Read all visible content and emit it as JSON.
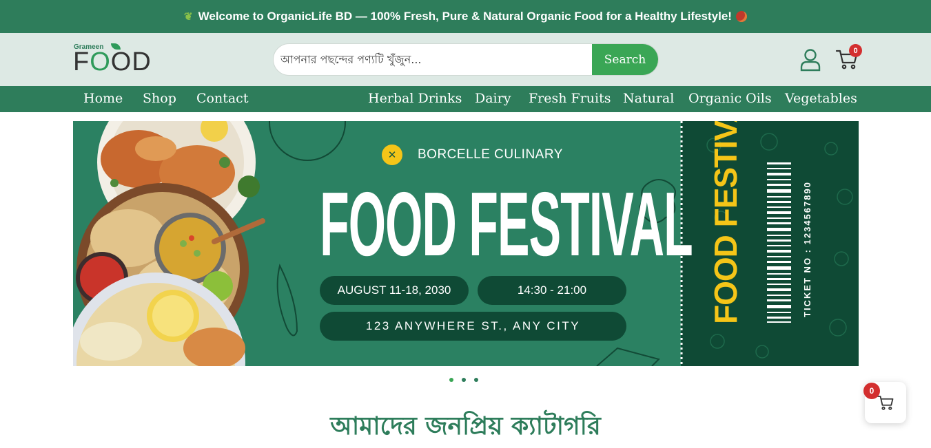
{
  "announcement": {
    "text": "Welcome to OrganicLife BD — 100% Fresh, Pure & Natural Organic Food for a Healthy Lifestyle!"
  },
  "logo": {
    "top": "Grameen",
    "main_f": "F",
    "main_o1": "O",
    "main_rest": "OD"
  },
  "search": {
    "placeholder": "আপনার পছন্দের পণ্যটি খুঁজুন...",
    "button_label": "Search"
  },
  "header": {
    "cart_count": "0"
  },
  "nav": {
    "left": [
      "Home",
      "Shop",
      "Contact"
    ],
    "right": [
      "Herbal Drinks",
      "Dairy",
      "Fresh Fruits",
      "Natural",
      "Organic Oils",
      "Vegetables"
    ]
  },
  "banner": {
    "brand": "BORCELLE CULINARY",
    "title": "FOOD FESTIVAL",
    "date": "AUGUST 11-18, 2030",
    "time": "14:30 - 21:00",
    "address": "123 ANYWHERE ST., ANY CITY",
    "stub_title": "FOOD FESTIVAL",
    "ticket": "TICKET NO : 1234567890",
    "colors": {
      "main": "#2b8162",
      "dark": "#0f4a35",
      "accent": "#f5c518"
    }
  },
  "slider": {
    "dot_count": 3
  },
  "section": {
    "title": "আমাদের জনপ্রিয় ক্যাটাগরি"
  },
  "floating_cart": {
    "count": "0"
  },
  "colors": {
    "primary": "#2e7d5b",
    "button": "#3aa655",
    "badge": "#d32f2f",
    "header_bg": "#dde9e4"
  }
}
